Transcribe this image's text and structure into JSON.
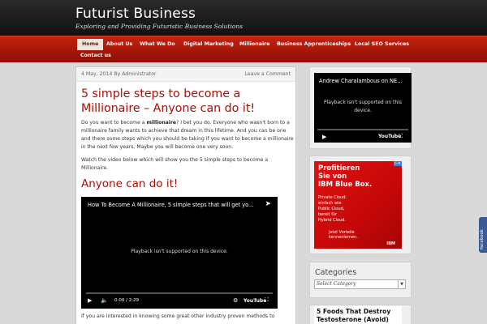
{
  "site": {
    "title": "Futurist Business",
    "description": "Exploring and Providing Futuristic Business Solutions"
  },
  "nav": {
    "items": [
      {
        "label": "Home"
      },
      {
        "label": "About Us"
      },
      {
        "label": "What We Do"
      },
      {
        "label": "Digital Marketing"
      },
      {
        "label": "Millionaire"
      },
      {
        "label": "Business Apprenticeships"
      },
      {
        "label": "Local SEO Services"
      },
      {
        "label": "Contact us"
      }
    ]
  },
  "post": {
    "date_author": "4 May, 2014 By Administrator",
    "comment_link": "Leave a Comment",
    "title": "5 simple steps to become a Millionaire – Anyone can do it!",
    "p1_before": "Do you want to become a ",
    "p1_bold": "millionaire",
    "p1_after": "? I bet you do.  Everyone who wasn't born to a millionaire family wants to achieve that dream in this lifetime.   And you can be one and there some steps which you should be taking if you want to become a millionaire in the next few years. Maybe you will become one very soon.",
    "p2": "Watch the video below which will show you the 5 simple steps to become a Millionaire.",
    "subheading": "Anyone can do it!",
    "p3": "If you are interested in knowing some great other industry proven methods to"
  },
  "main_video": {
    "title": "How To Become A Millionaire, 5 simple steps that will get yo...",
    "message": "Playback isn't supported on this device.",
    "time": "0:00 / 2:29",
    "logo": "YouTube"
  },
  "sidebar": {
    "video": {
      "title": "Andrew Charalambous on NE...",
      "message_line1": "Playback isn't supported on this",
      "message_line2": "device.",
      "logo": "YouTube"
    },
    "ad": {
      "headline_lines": [
        "Profitieren",
        "Sie von",
        "IBM Blue Box."
      ],
      "body_lines": [
        "Private Cloud:",
        "einfach wie",
        "Public Cloud,",
        "bereit für",
        "Hybrid Cloud."
      ],
      "footer_lines": [
        "Jetzt Vorteile",
        "kennenlernen."
      ],
      "brand": "IBM"
    },
    "categories": {
      "title": "Categories",
      "select_value": "Select Category"
    },
    "ad2": {
      "headline": "5 Foods That Destroy Testosterone (Avoid)"
    }
  },
  "facebook_tab": {
    "label": "facebook"
  },
  "colors": {
    "accent_red": "#a80f05",
    "nav_red": "#c4210f",
    "header_dark": "#1a1a1a",
    "facebook_blue": "#3b5998"
  }
}
